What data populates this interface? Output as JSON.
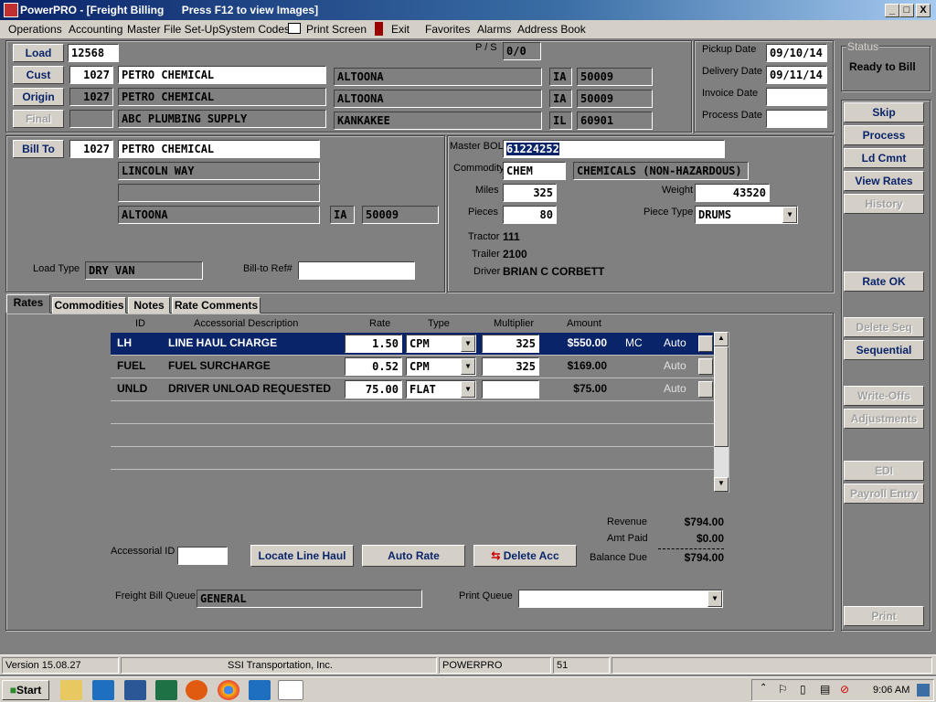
{
  "window": {
    "title": "PowerPRO - [Freight Billing",
    "hint": "Press F12 to view Images]",
    "controls": [
      "_",
      "□",
      "X"
    ]
  },
  "menu": [
    "Operations",
    "Accounting",
    "Master File Set-Up",
    "System Codes",
    "Print Screen",
    "Exit",
    "Favorites",
    "Alarms",
    "Address Book"
  ],
  "load": {
    "label": "Load",
    "value": "12568",
    "ps_label": "P / S",
    "ps_value": "0/0"
  },
  "cust": {
    "label": "Cust",
    "id": "1027",
    "name": "PETRO CHEMICAL",
    "city": "ALTOONA",
    "state": "IA",
    "zip": "50009"
  },
  "origin": {
    "label": "Origin",
    "id": "1027",
    "name": "PETRO CHEMICAL",
    "city": "ALTOONA",
    "state": "IA",
    "zip": "50009"
  },
  "final": {
    "label": "Final",
    "id": "",
    "name": "ABC PLUMBING SUPPLY",
    "city": "KANKAKEE",
    "state": "IL",
    "zip": "60901"
  },
  "dates": {
    "pickup_label": "Pickup Date",
    "pickup": "09/10/14",
    "delivery_label": "Delivery Date",
    "delivery": "09/11/14",
    "invoice_label": "Invoice Date",
    "invoice": "",
    "process_label": "Process Date",
    "process": ""
  },
  "status": {
    "label": "Status",
    "value": "Ready to Bill"
  },
  "side_buttons": [
    "Skip",
    "Process",
    "Ld Cmnt",
    "View Rates",
    "History",
    "Rate OK",
    "Delete Seq",
    "Sequential",
    "Write-Offs",
    "Adjustments",
    "EDI",
    "Payroll Entry",
    "Print"
  ],
  "billto": {
    "label": "Bill To",
    "id": "1027",
    "name": "PETRO CHEMICAL",
    "addr1": "LINCOLN WAY",
    "addr2": "",
    "city": "ALTOONA",
    "state": "IA",
    "zip": "50009",
    "load_type_label": "Load Type",
    "load_type": "DRY VAN",
    "ref_label": "Bill-to Ref#",
    "ref": ""
  },
  "shipment": {
    "bol_label": "Master BOL",
    "bol": "61224252",
    "commodity_label": "Commodity",
    "commodity": "CHEM",
    "commodity_desc": "CHEMICALS (NON-HAZARDOUS)",
    "miles_label": "Miles",
    "miles": "325",
    "weight_label": "Weight",
    "weight": "43520",
    "pieces_label": "Pieces",
    "pieces": "80",
    "piece_type_label": "Piece Type",
    "piece_type": "DRUMS",
    "tractor_label": "Tractor",
    "tractor": "111",
    "trailer_label": "Trailer",
    "trailer": "2100",
    "driver_label": "Driver",
    "driver": "BRIAN C CORBETT"
  },
  "tabs": [
    "Rates",
    "Commodities",
    "Notes",
    "Rate Comments"
  ],
  "grid": {
    "headers": [
      "ID",
      "Accessorial Description",
      "Rate",
      "Type",
      "Multiplier",
      "Amount"
    ],
    "rows": [
      {
        "id": "LH",
        "desc": "LINE HAUL CHARGE",
        "rate": "1.50",
        "type": "CPM",
        "mult": "325",
        "amount": "$550.00",
        "flag": "MC",
        "mode": "Auto"
      },
      {
        "id": "FUEL",
        "desc": "FUEL SURCHARGE",
        "rate": "0.52",
        "type": "CPM",
        "mult": "325",
        "amount": "$169.00",
        "flag": "",
        "mode": "Auto"
      },
      {
        "id": "UNLD",
        "desc": "DRIVER UNLOAD REQUESTED",
        "rate": "75.00",
        "type": "FLAT",
        "mult": "",
        "amount": "$75.00",
        "flag": "",
        "mode": "Auto"
      }
    ]
  },
  "totals": {
    "revenue_label": "Revenue",
    "revenue": "$794.00",
    "paid_label": "Amt Paid",
    "paid": "$0.00",
    "balance_label": "Balance Due",
    "balance": "$794.00"
  },
  "actions": {
    "acc_id_label": "Accessorial ID",
    "acc_id": "",
    "locate": "Locate Line Haul",
    "auto": "Auto Rate",
    "delete": "Delete Acc"
  },
  "queues": {
    "fb_label": "Freight Bill Queue",
    "fb": "GENERAL",
    "print_label": "Print Queue",
    "print": ""
  },
  "statusbar": [
    "Version 15.08.27",
    "SSI Transportation, Inc.",
    "POWERPRO",
    "51",
    ""
  ],
  "taskbar": {
    "start": "Start",
    "clock": "9:06 AM"
  }
}
